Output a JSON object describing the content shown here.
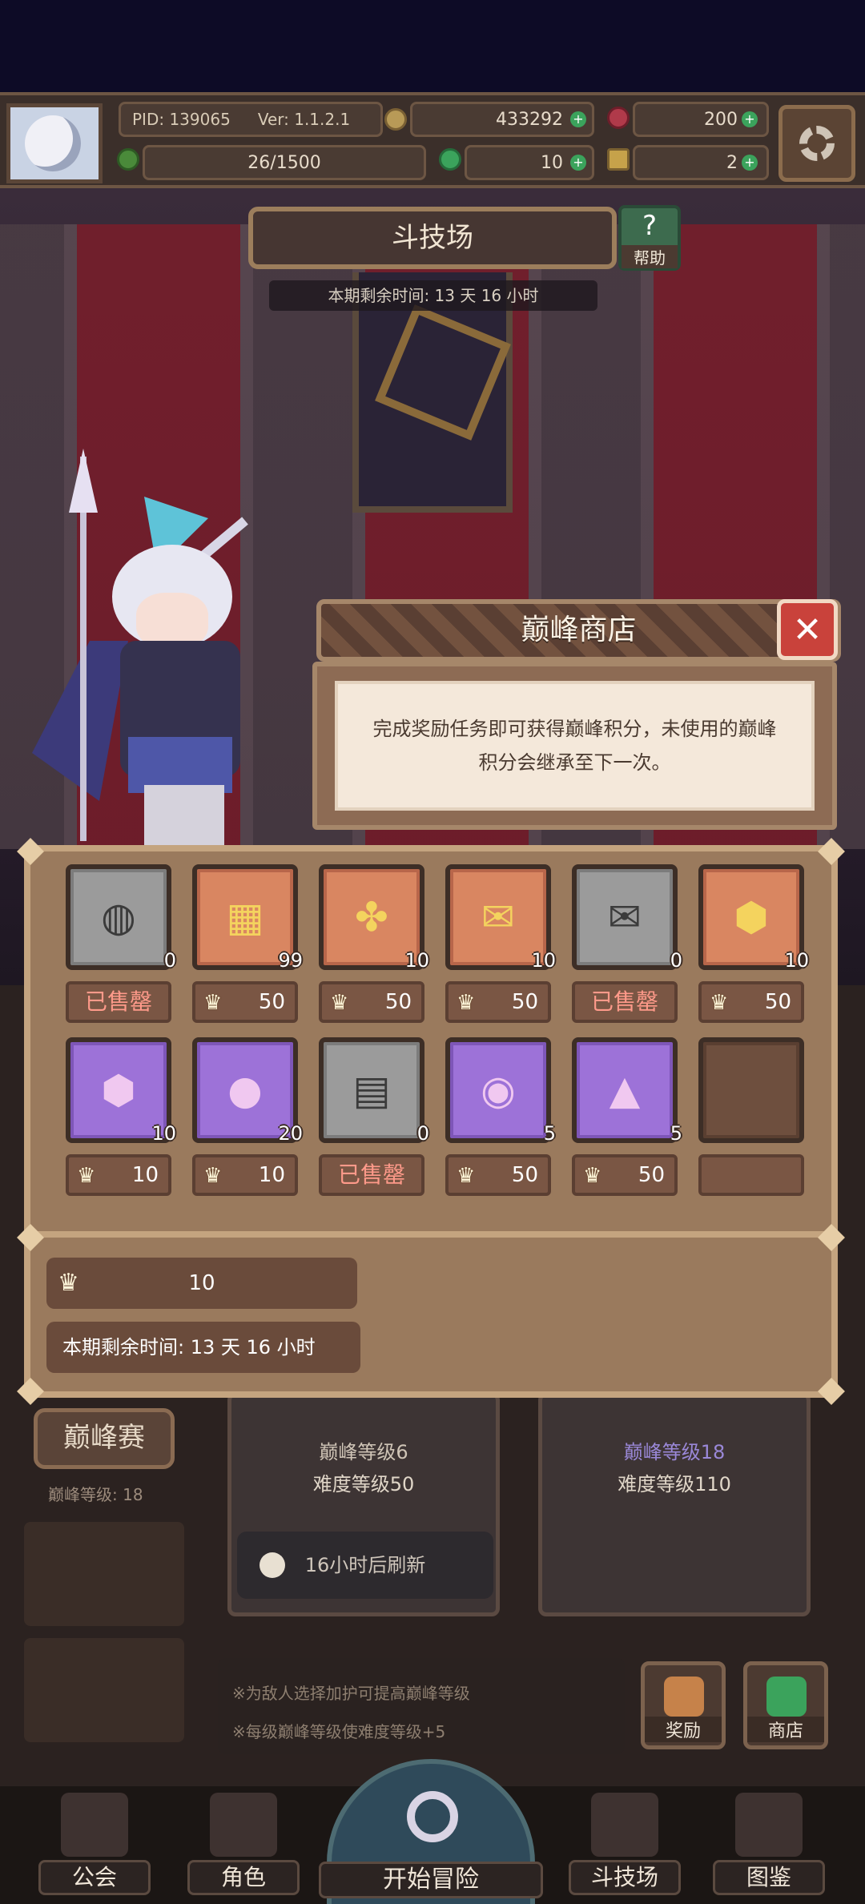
{
  "topbar": {
    "pid": "PID: 139065",
    "ver": "Ver: 1.1.2.1",
    "gold": "433292",
    "gems": "200",
    "stamina": "26/1500",
    "clover": "10",
    "keys": "2"
  },
  "arena": {
    "title": "斗技场",
    "help_label": "帮助",
    "help_glyph": "?",
    "season_time": "本期剩余时间: 13 天 16 小时"
  },
  "dialog": {
    "title": "巅峰商店",
    "close_glyph": "✕",
    "description": "完成奖励任务即可获得巅峰积分，未使用的巅峰积分会继承至下一次。"
  },
  "shop": {
    "items": [
      {
        "name": "gray-orb",
        "icon": "◍",
        "color": "gray",
        "qty": "0",
        "price": "",
        "sold": "已售罄"
      },
      {
        "name": "gold-chest",
        "icon": "▦",
        "color": "orange",
        "qty": "99",
        "price": "50",
        "sold": ""
      },
      {
        "name": "four-leaf-clover",
        "icon": "✤",
        "color": "orange",
        "qty": "10",
        "price": "50",
        "sold": ""
      },
      {
        "name": "gold-envelope",
        "icon": "✉",
        "color": "orange",
        "qty": "10",
        "price": "50",
        "sold": ""
      },
      {
        "name": "dark-envelope",
        "icon": "✉",
        "color": "gray",
        "qty": "0",
        "price": "",
        "sold": "已售罄"
      },
      {
        "name": "gold-gem",
        "icon": "⬢",
        "color": "orange",
        "qty": "10",
        "price": "50",
        "sold": ""
      },
      {
        "name": "purple-crystal",
        "icon": "⬢",
        "color": "purple",
        "qty": "10",
        "price": "10",
        "sold": ""
      },
      {
        "name": "pink-fruit",
        "icon": "●",
        "color": "purple",
        "qty": "20",
        "price": "10",
        "sold": ""
      },
      {
        "name": "gray-book",
        "icon": "▤",
        "color": "gray",
        "qty": "0",
        "price": "",
        "sold": "已售罄"
      },
      {
        "name": "purple-orb",
        "icon": "◉",
        "color": "purple",
        "qty": "5",
        "price": "50",
        "sold": ""
      },
      {
        "name": "purple-triangle",
        "icon": "▲",
        "color": "purple",
        "qty": "5",
        "price": "50",
        "sold": ""
      },
      {
        "name": "empty-slot",
        "icon": "",
        "color": "empty",
        "qty": "",
        "price": "",
        "sold": ""
      }
    ],
    "points": "10",
    "remaining_time": "本期剩余时间: 13 天 16 小时"
  },
  "background": {
    "peak_button": "巅峰赛",
    "peak_level": "巅峰等级: 18",
    "card1_line1": "巅峰等级6",
    "card1_line2": "难度等级50",
    "card2_line1": "巅峰等级18",
    "card2_line2": "难度等级110",
    "refresh": "16小时后刷新",
    "tip1": "※为敌人选择加护可提高巅峰等级",
    "tip2": "※每级巅峰等级使难度等级+5",
    "reward_button": "奖励",
    "shop_button": "商店"
  },
  "nav": {
    "guild": "公会",
    "character": "角色",
    "adventure": "开始冒险",
    "arena": "斗技场",
    "codex": "图鉴"
  },
  "colors": {
    "panel": "#9a7a5d",
    "panel_border": "#c4a47f",
    "sold_out": "#ff9a8a",
    "close_red": "#c9423b"
  }
}
